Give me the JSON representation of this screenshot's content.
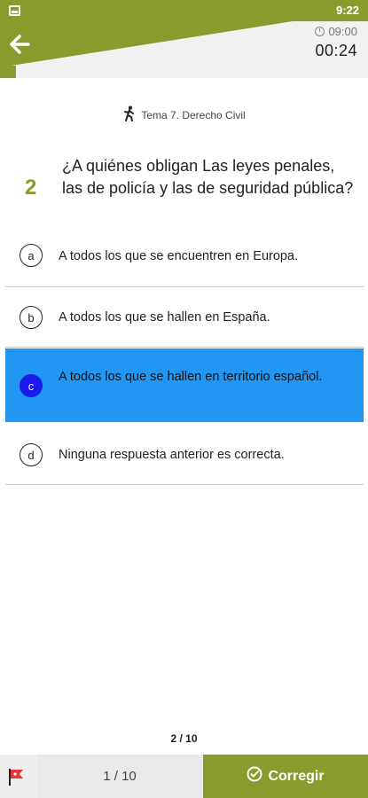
{
  "status_bar": {
    "time": "9:22"
  },
  "header": {
    "time_limit": "09:00",
    "elapsed": "00:24",
    "accent_color": "#8a9b2e"
  },
  "topic": {
    "label": "Tema 7. Derecho Civil",
    "icon": "person-walking-icon"
  },
  "question": {
    "number": "2",
    "text": "¿A quiénes obligan Las leyes penales, las de policía y las de seguridad pública?"
  },
  "options": [
    {
      "letter": "a",
      "text": "A todos los que se encuentren en Europa.",
      "selected": false
    },
    {
      "letter": "b",
      "text": "A todos los que se hallen en España.",
      "selected": false
    },
    {
      "letter": "c",
      "text": "A todos los que se hallen en territorio español.",
      "selected": true
    },
    {
      "letter": "d",
      "text": "Ninguna respuesta anterior es correcta.",
      "selected": false
    }
  ],
  "page_counter": "2 / 10",
  "footer": {
    "progress": "1 / 10",
    "correct_label": "Corregir",
    "selected_color": "#2196f3"
  }
}
